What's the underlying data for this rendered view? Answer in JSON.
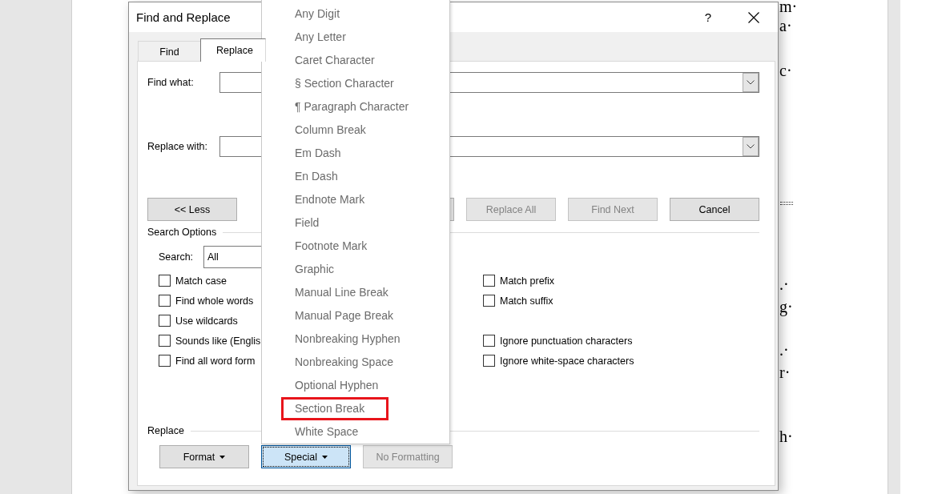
{
  "document": {
    "fragments": [
      "m·",
      "a·",
      "c·",
      ".·",
      "g·",
      ".·",
      "r·",
      "h·"
    ]
  },
  "dialog": {
    "title": "Find and Replace",
    "help_label": "?",
    "tabs": [
      {
        "label": "Find",
        "selected": false
      },
      {
        "label": "Replace",
        "selected": true
      }
    ],
    "fields": [
      {
        "label": "Find what:"
      },
      {
        "label": "Replace with:"
      }
    ],
    "less_button": {
      "label": "<< Less"
    },
    "action_buttons": [
      {
        "label": "Replace All",
        "disabled": true
      },
      {
        "label": "Find Next",
        "disabled": true
      },
      {
        "label": "Cancel",
        "disabled": false
      }
    ],
    "search_options": {
      "title": "Search Options",
      "search_label": "Search:",
      "search_value": "All",
      "left_options": [
        {
          "label": "Match case",
          "checked": false
        },
        {
          "label": "Find whole words",
          "checked": false
        },
        {
          "label": "Use wildcards",
          "checked": false
        },
        {
          "label": "Sounds like (Englis",
          "checked": false
        },
        {
          "label": "Find all word form",
          "checked": false
        }
      ],
      "right_option_groups": [
        {
          "options": [
            {
              "label": "Match prefix",
              "checked": false
            },
            {
              "label": "Match suffix",
              "checked": false
            }
          ]
        },
        {
          "options": [
            {
              "label": "Ignore punctuation characters",
              "checked": false
            },
            {
              "label": "Ignore white-space characters",
              "checked": false
            }
          ]
        }
      ]
    },
    "replace_options": {
      "title": "Replace",
      "buttons": [
        {
          "label": "Format",
          "dropdown": true,
          "active": false,
          "disabled": false
        },
        {
          "label": "Special",
          "dropdown": true,
          "active": true,
          "disabled": false
        },
        {
          "label": "No Formatting",
          "dropdown": false,
          "active": false,
          "disabled": true
        }
      ]
    }
  },
  "special_menu": {
    "items": [
      {
        "label": "Any Digit",
        "highlighted": false
      },
      {
        "label": "Any Letter",
        "highlighted": false
      },
      {
        "label": "Caret Character",
        "highlighted": false
      },
      {
        "label": "§ Section Character",
        "highlighted": false
      },
      {
        "label": "¶ Paragraph Character",
        "highlighted": false
      },
      {
        "label": "Column Break",
        "highlighted": false
      },
      {
        "label": "Em Dash",
        "highlighted": false
      },
      {
        "label": "En Dash",
        "highlighted": false
      },
      {
        "label": "Endnote Mark",
        "highlighted": false
      },
      {
        "label": "Field",
        "highlighted": false
      },
      {
        "label": "Footnote Mark",
        "highlighted": false
      },
      {
        "label": "Graphic",
        "highlighted": false
      },
      {
        "label": "Manual Line Break",
        "highlighted": false
      },
      {
        "label": "Manual Page Break",
        "highlighted": false
      },
      {
        "label": "Nonbreaking Hyphen",
        "highlighted": false
      },
      {
        "label": "Nonbreaking Space",
        "highlighted": false
      },
      {
        "label": "Optional Hyphen",
        "highlighted": false
      },
      {
        "label": "Section Break",
        "highlighted": true
      },
      {
        "label": "White Space",
        "highlighted": false
      }
    ]
  }
}
